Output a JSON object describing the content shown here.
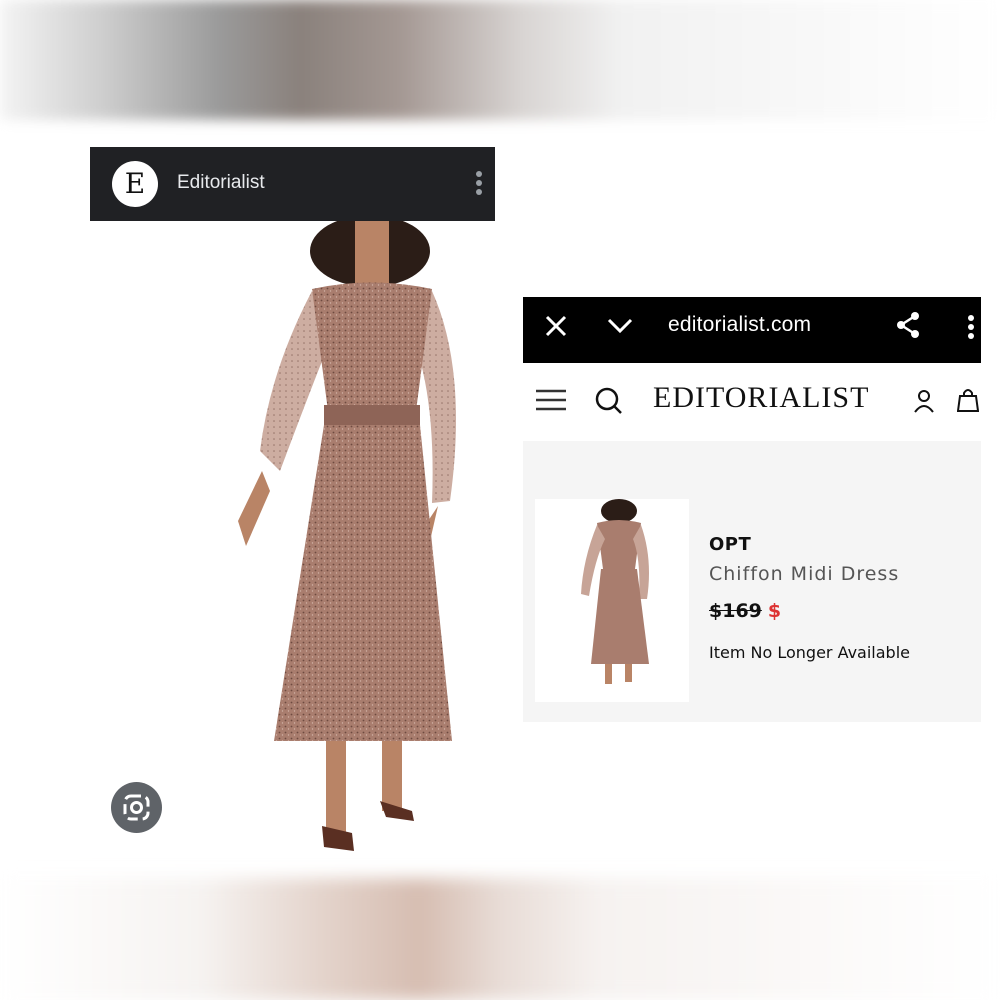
{
  "left_card": {
    "logo_letter": "E",
    "title": "Editorialist",
    "menu_icon": "more-vert-icon",
    "lens_icon": "google-lens-icon"
  },
  "browser": {
    "close_icon": "close-icon",
    "collapse_icon": "chevron-down-icon",
    "url": "editorialist.com",
    "share_icon": "share-icon",
    "menu_icon": "more-vert-icon"
  },
  "site_nav": {
    "menu_icon": "hamburger-icon",
    "search_icon": "search-icon",
    "brand": "EDITORIALIST",
    "account_icon": "user-icon",
    "bag_icon": "shopping-bag-icon"
  },
  "product": {
    "brand": "OPT",
    "name": "Chiffon Midi Dress",
    "original_price": "$169",
    "sale_price": "$",
    "status": "Item No Longer Available"
  },
  "colors": {
    "dress": "#a87c6e",
    "sale_price": "#d33333",
    "dark_header": "#202124"
  }
}
